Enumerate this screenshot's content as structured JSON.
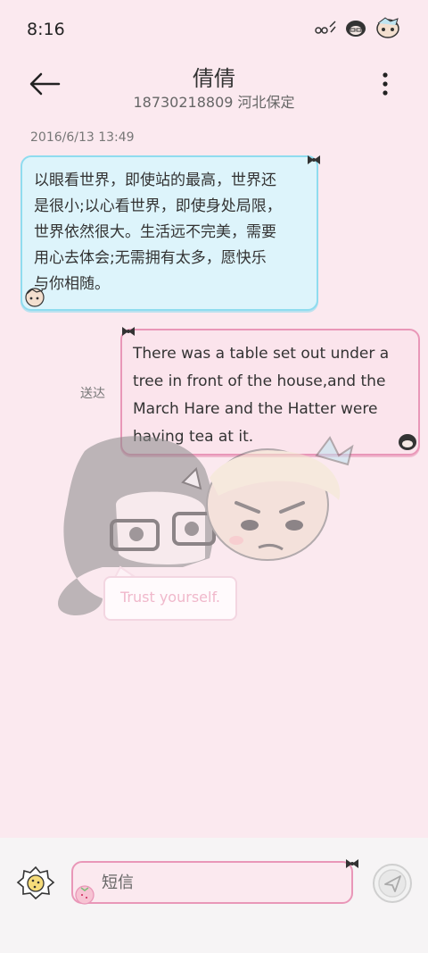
{
  "status_bar": {
    "time": "8:16",
    "icons": [
      "battery-doodle-icon",
      "girl-avatar-icon",
      "boy-avatar-icon"
    ]
  },
  "header": {
    "back_icon": "arrow-left-icon",
    "title": "倩倩",
    "subtitle": "18730218809 河北保定",
    "more_icon": "more-vertical-icon"
  },
  "conversation": {
    "timestamp": "2016/6/13 13:49",
    "messages": [
      {
        "direction": "incoming",
        "lines": [
          "以眼看世界，即使站的最高，世界还",
          "是很小;以心看世界，即使身处局限，",
          "世界依然很大。生活远不完美，需要",
          "用心去体会;无需拥有太多，愿快乐",
          "与你相随。"
        ]
      },
      {
        "direction": "outgoing",
        "lines": [
          "There was a table set out under a",
          "tree in front of the house,and the",
          "March Hare and the Hatter were",
          "having tea at it."
        ],
        "status": "送达"
      }
    ]
  },
  "illustration": {
    "caption": "Trust yourself."
  },
  "composer": {
    "placeholder": "短信",
    "emoji_icon": "cookie-icon",
    "send_icon": "send-icon"
  },
  "colors": {
    "background": "#fbe9ef",
    "incoming_bubble": "#ddf4fb",
    "incoming_border": "#8fdcef",
    "outgoing_bubble": "#fbe4ec",
    "outgoing_border": "#e997b8"
  }
}
